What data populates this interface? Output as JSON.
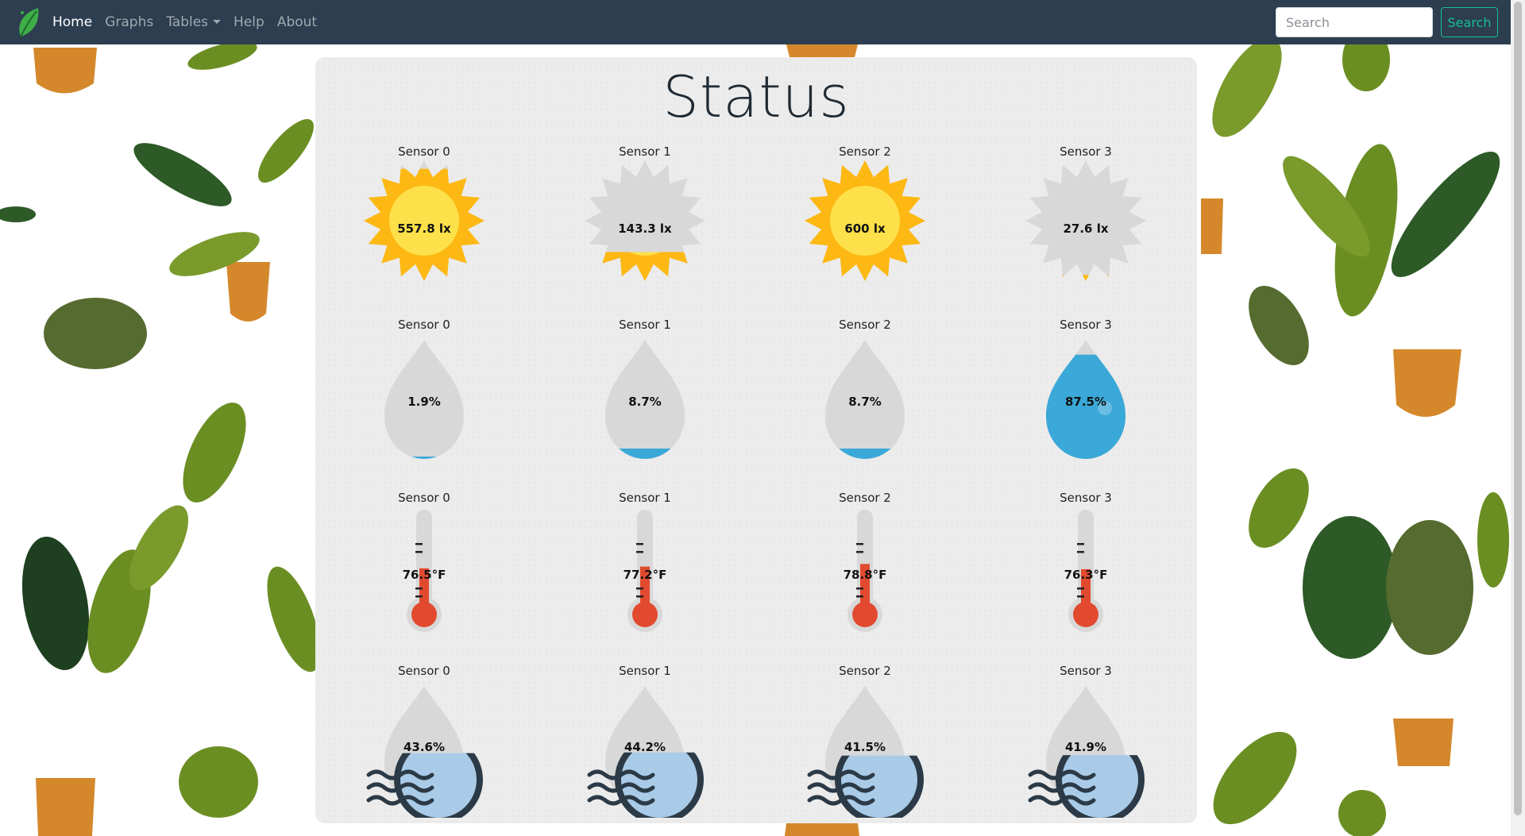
{
  "nav": {
    "items": [
      {
        "label": "Home",
        "active": true
      },
      {
        "label": "Graphs",
        "active": false
      },
      {
        "label": "Tables",
        "active": false,
        "dropdown": true
      },
      {
        "label": "Help",
        "active": false
      },
      {
        "label": "About",
        "active": false
      }
    ],
    "search_placeholder": "Search",
    "search_button": "Search"
  },
  "page": {
    "title": "Status"
  },
  "rows": [
    {
      "type": "light",
      "sensors": [
        {
          "label": "Sensor 0",
          "value": "557.8 lx",
          "level": 0.93
        },
        {
          "label": "Sensor 1",
          "value": "143.3 lx",
          "level": 0.24
        },
        {
          "label": "Sensor 2",
          "value": "600 lx",
          "level": 1.0
        },
        {
          "label": "Sensor 3",
          "value": "27.6 lx",
          "level": 0.05
        }
      ]
    },
    {
      "type": "moisture",
      "sensors": [
        {
          "label": "Sensor 0",
          "value": "1.9%",
          "level": 0.019
        },
        {
          "label": "Sensor 1",
          "value": "8.7%",
          "level": 0.087
        },
        {
          "label": "Sensor 2",
          "value": "8.7%",
          "level": 0.087
        },
        {
          "label": "Sensor 3",
          "value": "87.5%",
          "level": 0.875
        }
      ]
    },
    {
      "type": "temperature",
      "sensors": [
        {
          "label": "Sensor 0",
          "value": "76.5°F",
          "level": 0.42
        },
        {
          "label": "Sensor 1",
          "value": "77.2°F",
          "level": 0.44
        },
        {
          "label": "Sensor 2",
          "value": "78.8°F",
          "level": 0.47
        },
        {
          "label": "Sensor 3",
          "value": "76.3°F",
          "level": 0.41
        }
      ]
    },
    {
      "type": "humidity",
      "sensors": [
        {
          "label": "Sensor 0",
          "value": "43.6%",
          "level": 0.436
        },
        {
          "label": "Sensor 1",
          "value": "44.2%",
          "level": 0.442
        },
        {
          "label": "Sensor 2",
          "value": "41.5%",
          "level": 0.415
        },
        {
          "label": "Sensor 3",
          "value": "41.9%",
          "level": 0.419
        }
      ]
    }
  ],
  "colors": {
    "navbar": "#2c3e50",
    "accent": "#18bc9c",
    "sun": "#fdb813",
    "sun_core": "#fde04a",
    "water": "#3aa8d8",
    "thermo": "#e24a2f",
    "humidity": "#a9cbe8",
    "empty": "#d8d8d8"
  }
}
